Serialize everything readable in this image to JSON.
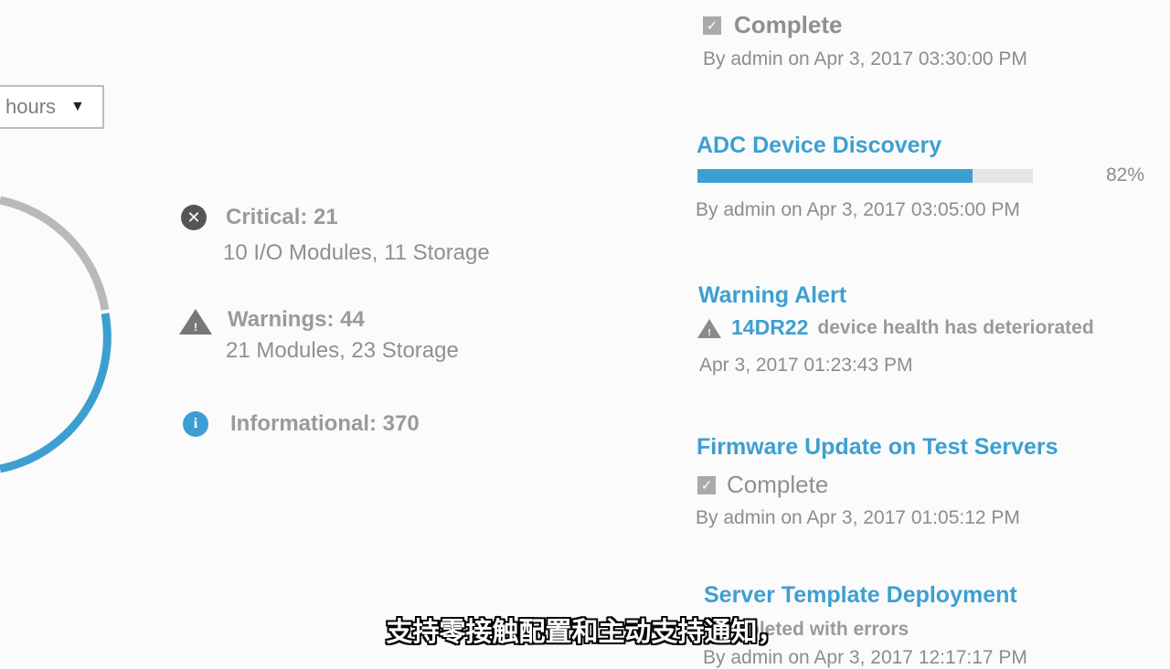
{
  "header": {
    "blurred_title": ""
  },
  "time_range": {
    "selected": "hours"
  },
  "health_summary": {
    "donut": {
      "critical": 21,
      "warnings": 44,
      "informational": 370,
      "colors": {
        "gray": "#b9b9b5",
        "blue": "#3d9fd1"
      }
    },
    "critical": {
      "title": "Critical: 21",
      "detail": "10 I/O Modules, 11 Storage"
    },
    "warnings": {
      "title": "Warnings: 44",
      "detail": "21 Modules, 23 Storage"
    },
    "informational": {
      "title": "Informational: 370"
    }
  },
  "activities": [
    {
      "status_label": "Complete",
      "meta": "By admin on Apr 3, 2017 03:30:00 PM"
    },
    {
      "title": "ADC Device Discovery",
      "progress": 0.82,
      "progress_label": "82%",
      "meta": "By admin on Apr 3, 2017 03:05:00 PM"
    },
    {
      "title": "Warning Alert",
      "device": "14DR22",
      "message": "device health has deteriorated",
      "meta": "Apr 3, 2017 01:23:43 PM"
    },
    {
      "title": "Firmware Update on Test Servers",
      "status_label": "Complete",
      "meta": "By admin on Apr 3, 2017 01:05:12 PM"
    },
    {
      "title": "Server Template Deployment",
      "status_label": "pleted with errors",
      "meta": "By admin on Apr 3, 2017 12:17:17 PM"
    }
  ],
  "caption": "支持零接触配置和主动支持通知，",
  "colors": {
    "accent": "#3d9fd1",
    "critical_icon": "#555555",
    "warning_icon": "#777777",
    "info_icon": "#3d9fd1"
  },
  "icons": [
    "critical-x-icon",
    "warning-triangle-icon",
    "info-icon",
    "checkbox-icon",
    "caret-down-icon"
  ]
}
